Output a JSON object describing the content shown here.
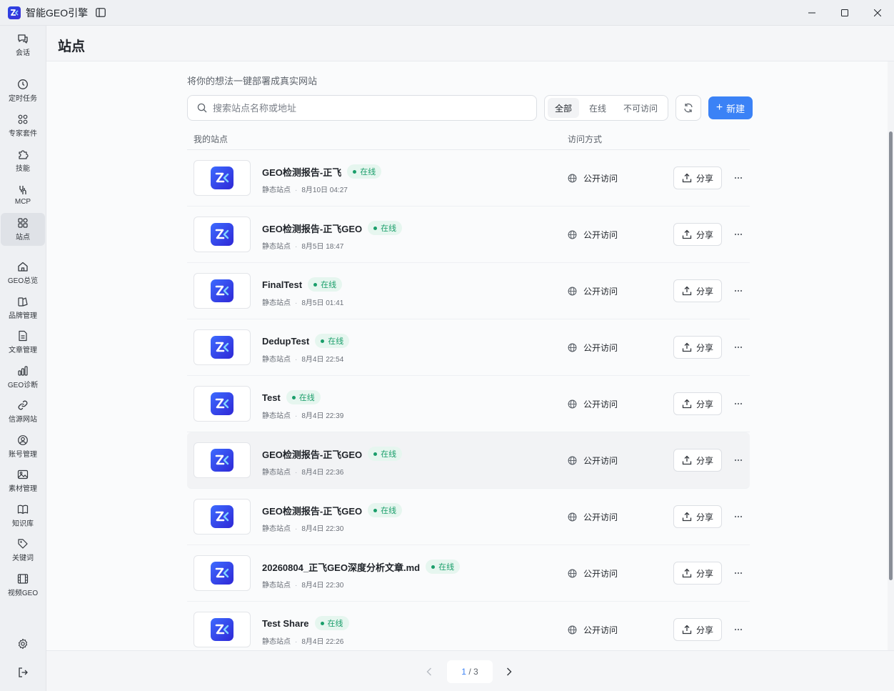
{
  "window": {
    "title": "智能GEO引擎"
  },
  "sidebar": {
    "items": [
      {
        "label": "会话",
        "icon": "chat-icon"
      },
      {
        "label": "定时任务",
        "icon": "clock-icon"
      },
      {
        "label": "专家套件",
        "icon": "grid-dots-icon"
      },
      {
        "label": "技能",
        "icon": "puzzle-icon"
      },
      {
        "label": "MCP",
        "icon": "plug-icon"
      },
      {
        "label": "站点",
        "icon": "sites-icon",
        "active": true
      },
      {
        "label": "GEO总览",
        "icon": "home-icon"
      },
      {
        "label": "品牌管理",
        "icon": "brand-icon"
      },
      {
        "label": "文章管理",
        "icon": "document-icon"
      },
      {
        "label": "GEO诊断",
        "icon": "bar-chart-icon"
      },
      {
        "label": "信源网站",
        "icon": "link-icon"
      },
      {
        "label": "账号管理",
        "icon": "user-icon"
      },
      {
        "label": "素材管理",
        "icon": "image-icon"
      },
      {
        "label": "知识库",
        "icon": "book-icon"
      },
      {
        "label": "关键词",
        "icon": "tag-icon"
      },
      {
        "label": "视频GEO",
        "icon": "film-icon"
      }
    ],
    "bottom": [
      {
        "icon": "gear-icon"
      },
      {
        "icon": "logout-icon"
      }
    ]
  },
  "header": {
    "title": "站点"
  },
  "main": {
    "subtitle": "将你的想法一键部署成真实网站",
    "search": {
      "placeholder": "搜索站点名称或地址",
      "value": ""
    },
    "filters": [
      {
        "label": "全部",
        "active": true
      },
      {
        "label": "在线"
      },
      {
        "label": "不可访问"
      }
    ],
    "new_label": "新建",
    "columns": {
      "sites": "我的站点",
      "access": "访问方式"
    },
    "rows": [
      {
        "name": "GEO检测报告-正飞",
        "status": "在线",
        "type": "静态站点",
        "time": "8月10日 04:27",
        "access": "公开访问",
        "share": "分享"
      },
      {
        "name": "GEO检测报告-正飞GEO",
        "status": "在线",
        "type": "静态站点",
        "time": "8月5日 18:47",
        "access": "公开访问",
        "share": "分享"
      },
      {
        "name": "FinalTest",
        "status": "在线",
        "type": "静态站点",
        "time": "8月5日 01:41",
        "access": "公开访问",
        "share": "分享"
      },
      {
        "name": "DedupTest",
        "status": "在线",
        "type": "静态站点",
        "time": "8月4日 22:54",
        "access": "公开访问",
        "share": "分享"
      },
      {
        "name": "Test",
        "status": "在线",
        "type": "静态站点",
        "time": "8月4日 22:39",
        "access": "公开访问",
        "share": "分享"
      },
      {
        "name": "GEO检测报告-正飞GEO",
        "status": "在线",
        "type": "静态站点",
        "time": "8月4日 22:36",
        "access": "公开访问",
        "share": "分享"
      },
      {
        "name": "GEO检测报告-正飞GEO",
        "status": "在线",
        "type": "静态站点",
        "time": "8月4日 22:30",
        "access": "公开访问",
        "share": "分享"
      },
      {
        "name": "20260804_正飞GEO深度分析文章.md",
        "status": "在线",
        "type": "静态站点",
        "time": "8月4日 22:30",
        "access": "公开访问",
        "share": "分享"
      },
      {
        "name": "Test Share",
        "status": "在线",
        "type": "静态站点",
        "time": "8月4日 22:26",
        "access": "公开访问",
        "share": "分享"
      }
    ]
  },
  "pagination": {
    "current": "1",
    "separator": " / ",
    "total": "3"
  },
  "colors": {
    "accent": "#3b82f6",
    "online": "#1a9e6a"
  }
}
